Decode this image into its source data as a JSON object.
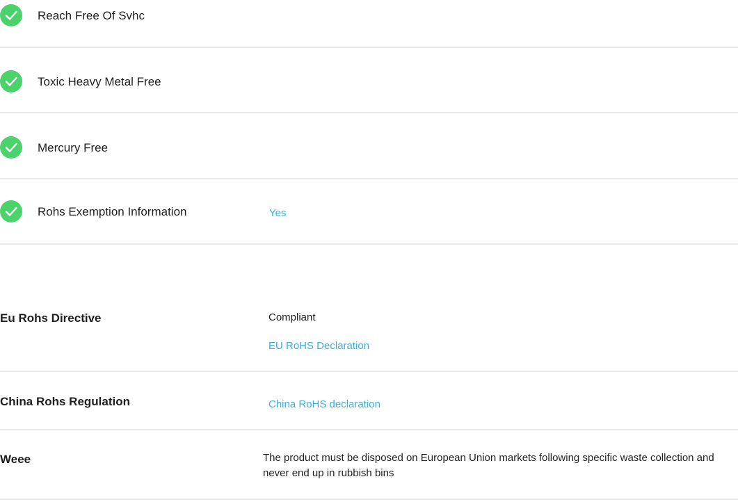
{
  "checks": [
    {
      "label": "Reach Free Of Svhc"
    },
    {
      "label": "Toxic Heavy Metal Free"
    },
    {
      "label": "Mercury Free"
    },
    {
      "label": "Rohs Exemption Information",
      "value": "Yes"
    }
  ],
  "regulations": {
    "eu": {
      "label": "Eu Rohs Directive",
      "status": "Compliant",
      "link": "EU RoHS Declaration"
    },
    "china": {
      "label": "China Rohs Regulation",
      "link": "China RoHS declaration"
    },
    "weee": {
      "label": "Weee",
      "text": "The product must be disposed on European Union markets following specific waste collection and never end up in rubbish bins"
    }
  },
  "icons": {
    "check": "check-circle-icon"
  },
  "colors": {
    "check_green": "#4cd26a",
    "link_blue": "#3aaee0",
    "divider": "#e8e8e8"
  }
}
